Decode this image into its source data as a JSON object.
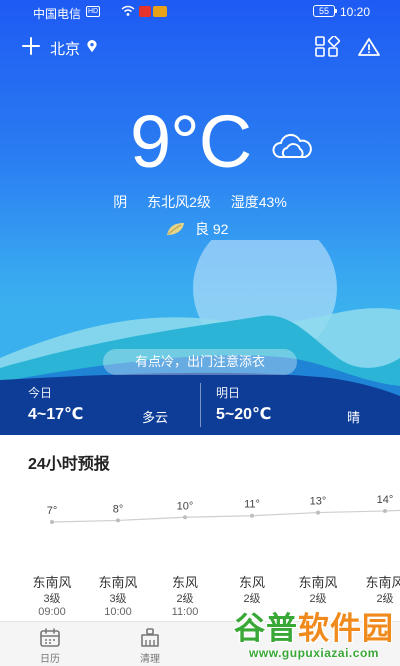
{
  "status_bar": {
    "carrier": "中国电信",
    "hd": "HD",
    "battery": "55",
    "time": "10:20"
  },
  "header": {
    "city": "北京",
    "icons": [
      "plus-icon",
      "location-pin-icon",
      "apps-grid-icon",
      "warning-icon"
    ]
  },
  "hero": {
    "temp_value": "9",
    "temp_unit": "°C",
    "weather_icon": "cloud-icon",
    "condition": "阴",
    "wind": "东北风2级",
    "humidity": "湿度43%",
    "aqi_label": "良 92",
    "aqi_icon": "leaf-icon"
  },
  "advice": "有点冷，出门注意添衣",
  "today": {
    "label": "今日",
    "range": "4~17℃",
    "condition": "多云"
  },
  "tomorrow": {
    "label": "明日",
    "range": "5~20℃",
    "condition": "晴"
  },
  "forecast": {
    "title": "24小时预报",
    "temps": [
      7,
      8,
      10,
      11,
      13,
      14
    ],
    "temp_labels": [
      "7°",
      "8°",
      "10°",
      "11°",
      "13°",
      "14°"
    ],
    "winds": [
      "东南风",
      "东南风",
      "东风",
      "东风",
      "东南风",
      "东南风"
    ],
    "levels": [
      "3级",
      "3级",
      "2级",
      "2级",
      "2级",
      "2级"
    ],
    "times": [
      "09:00",
      "10:00",
      "11:00"
    ]
  },
  "tabs": [
    {
      "label": "日历",
      "icon": "calendar-icon"
    },
    {
      "label": "清理",
      "icon": "clean-icon"
    }
  ],
  "watermark": {
    "part1": "谷普",
    "part2": "软件园",
    "url": "www.gupuxiazai.com"
  },
  "colors": {
    "sky_top": "#1e5af3",
    "sky_bottom": "#3ab0ee",
    "wave_dark": "#0e3d98",
    "curve_line": "#cfcfcf",
    "watermark_green": "#3aa836",
    "watermark_orange": "#f08a1c"
  }
}
